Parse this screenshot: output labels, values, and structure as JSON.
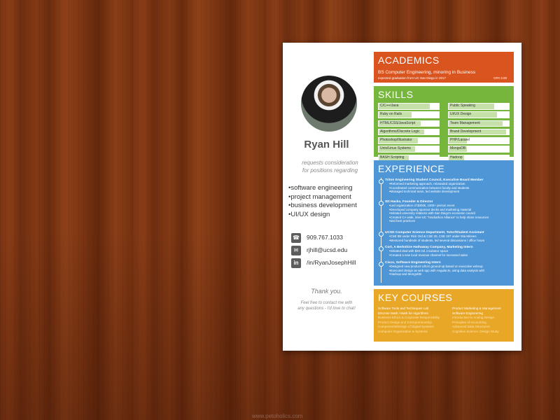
{
  "watermark": "www.petoholics.com",
  "colors": {
    "academics": "#d9541f",
    "skills": "#77b63d",
    "experience": "#4e96d6",
    "courses": "#e9a728",
    "wood": "#7a3413"
  },
  "profile": {
    "name": "Ryan Hill",
    "request_line1": "requests consideration",
    "request_line2": "for positions regarding",
    "interests": [
      "software engineering",
      "project management",
      "business development",
      "UI/UX design"
    ],
    "contacts": [
      {
        "icon": "phone-icon",
        "glyph": "☎",
        "text": "909.767.1033"
      },
      {
        "icon": "mail-icon",
        "glyph": "✉",
        "text": "rjhill@ucsd.edu"
      },
      {
        "icon": "linkedin-icon",
        "glyph": "in",
        "text": "/in/RyanJosephHill"
      }
    ],
    "thanks": "Thank you.",
    "thanks_sub1": "Feel free to contact me with",
    "thanks_sub2": "any questions - I'd love to chat!"
  },
  "academics": {
    "title": "ACADEMICS",
    "degree": "BS Computer Engineering, minoring in Business",
    "graduation": "expected graduation from UC San Diego in 2017",
    "gpa": "GPA 3.00"
  },
  "skills": {
    "title": "SKILLS",
    "left": [
      {
        "label": "C/C++/Java",
        "level": 0.85
      },
      {
        "label": "Ruby on Rails",
        "level": 0.55
      },
      {
        "label": "HTML/CSS/JavaScript",
        "level": 0.7
      },
      {
        "label": "Algorithms/Discrete Logic",
        "level": 0.75
      },
      {
        "label": "Photoshop/Illustrator",
        "level": 0.65
      },
      {
        "label": "Unix/Linux Systems",
        "level": 0.6
      },
      {
        "label": "BASH Scripting",
        "level": 0.5
      }
    ],
    "right": [
      {
        "label": "Public Speaking",
        "level": 0.75
      },
      {
        "label": "UI/UX Design",
        "level": 0.8
      },
      {
        "label": "Team Management",
        "level": 0.9
      },
      {
        "label": "Brand Development",
        "level": 0.95
      },
      {
        "label": "PHP/Laravel",
        "level": 0.3
      },
      {
        "label": "MongoDB",
        "level": 0.3
      },
      {
        "label": "Hadoop",
        "level": 0.25
      }
    ]
  },
  "experience": {
    "title": "EXPERIENCE",
    "jobs": [
      {
        "title": "Triton Engineering Student Council,  Executive Board Member",
        "bullets": [
          "Reformed marketing approach, rebranded organization",
          "Coordinated communication between faculty and students",
          "Managed technical team, led website development"
        ]
      },
      {
        "title": "SD Hacks,  Founder & Director",
        "bullets": [
          "Led organization of $300k, 1000+ person event",
          "Developed company sponsor decks and marketing material",
          "Initiated university relations with San Diego's economic council",
          "Created CA wide, inter-UC \"Hackathon Alliance\" to help share resources",
          "and best practices"
        ]
      },
      {
        "title": "UCSD Computer Science Department,  Tutor/Student Assistant",
        "bullets": [
          "CSE 8B under Rick Ord & CSE 20, CSE 197 under Mia Minnes",
          "Mentored hundreds of students, led several discussions / office hours"
        ]
      },
      {
        "title": "Cort, A Berkshire Hathaway Company,  Marketing Intern",
        "bullets": [
          "Initiated deal with $20 mil. incubator space",
          "Created a new local revenue channel for increased sales"
        ]
      },
      {
        "title": "Cisco,  Software Engineering Intern",
        "bullets": [
          "Designed new product UI/UX ground-up based on executive writeup",
          "Executed design as web app with AngularJs, using data analysis with",
          "Hadoop and MongoDB"
        ]
      }
    ]
  },
  "courses": {
    "title": "KEY COURSES",
    "left": [
      "Software Tools and Techniques Lab",
      "Discrete Math / Math for Algorithms",
      "Business Ethics & Corporate Responsibility",
      "Product Design and Entrepreneurship",
      "Components/Design of Digital Systems",
      "Computer Organization & Systems"
    ],
    "right": [
      "Product Marketing & Management",
      "Software Engineering",
      "Introduction to Analog Design",
      "Principles of Accounting",
      "Advanced Data Structures",
      "Cognitive Science: Design Study"
    ]
  }
}
